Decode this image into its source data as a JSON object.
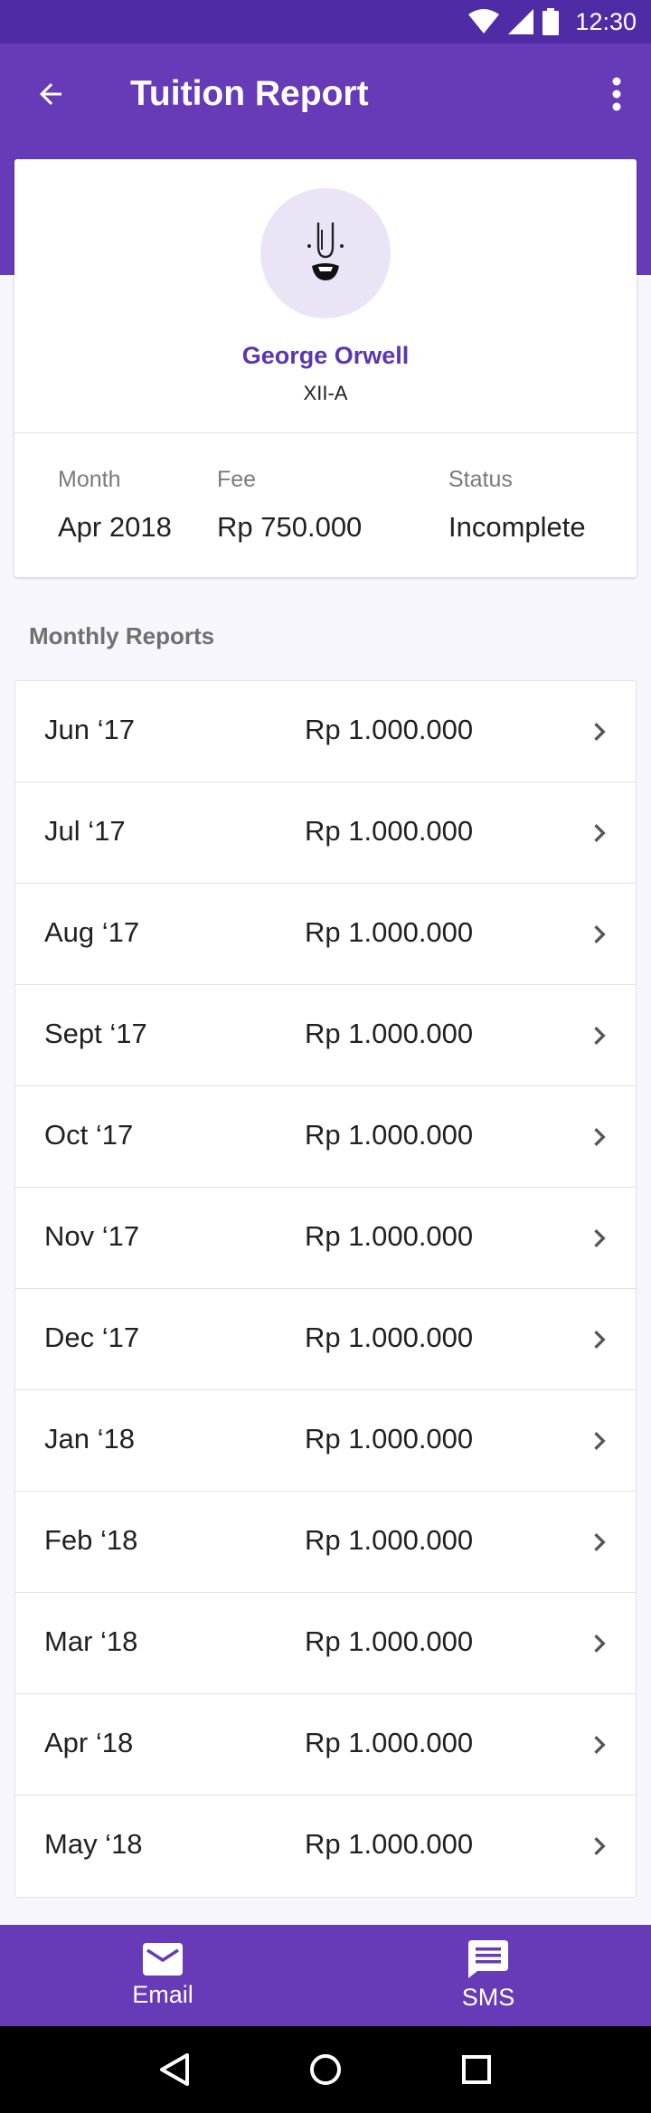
{
  "status_bar": {
    "time": "12:30"
  },
  "header": {
    "title": "Tuition Report"
  },
  "profile": {
    "name": "George Orwell",
    "class": "XII-A",
    "month_label": "Month",
    "month_value": "Apr 2018",
    "fee_label": "Fee",
    "fee_value": "Rp 750.000",
    "status_label": "Status",
    "status_value": "Incomplete"
  },
  "reports": {
    "section_title": "Monthly Reports",
    "items": [
      {
        "month": "Jun ‘17",
        "amount": "Rp 1.000.000"
      },
      {
        "month": "Jul ‘17",
        "amount": "Rp 1.000.000"
      },
      {
        "month": "Aug ‘17",
        "amount": "Rp 1.000.000"
      },
      {
        "month": "Sept ‘17",
        "amount": "Rp 1.000.000"
      },
      {
        "month": "Oct ‘17",
        "amount": "Rp 1.000.000"
      },
      {
        "month": "Nov ‘17",
        "amount": "Rp 1.000.000"
      },
      {
        "month": "Dec ‘17",
        "amount": "Rp 1.000.000"
      },
      {
        "month": "Jan ‘18",
        "amount": "Rp 1.000.000"
      },
      {
        "month": "Feb ‘18",
        "amount": "Rp 1.000.000"
      },
      {
        "month": "Mar ‘18",
        "amount": "Rp 1.000.000"
      },
      {
        "month": "Apr ‘18",
        "amount": "Rp 1.000.000"
      },
      {
        "month": "May ‘18",
        "amount": "Rp 1.000.000"
      }
    ]
  },
  "bottom_bar": {
    "email_label": "Email",
    "sms_label": "SMS"
  },
  "colors": {
    "primary": "#673ab7",
    "primary_dark": "#4f2ba6",
    "accent_text": "#5b35b3"
  },
  "icons": [
    "wifi-icon",
    "signal-icon",
    "battery-icon",
    "back-arrow-icon",
    "more-vert-icon",
    "avatar-face-icon",
    "chevron-right-icon",
    "email-icon",
    "sms-icon",
    "nav-back-icon",
    "nav-home-icon",
    "nav-recents-icon"
  ]
}
